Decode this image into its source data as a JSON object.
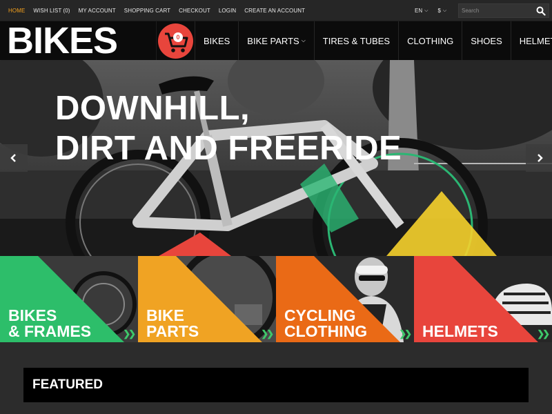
{
  "top_links": [
    {
      "label": "HOME",
      "active": true
    },
    {
      "label": "WISH LIST (0)",
      "active": false
    },
    {
      "label": "MY ACCOUNT",
      "active": false
    },
    {
      "label": "SHOPPING CART",
      "active": false
    },
    {
      "label": "CHECKOUT",
      "active": false
    },
    {
      "label": "LOGIN",
      "active": false
    },
    {
      "label": "CREATE AN ACCOUNT",
      "active": false
    }
  ],
  "language": "EN",
  "currency": "$",
  "search": {
    "placeholder": "Search",
    "value": ""
  },
  "logo": "BIKES",
  "cart": {
    "count": "0"
  },
  "nav": [
    {
      "label": "BIKES",
      "dropdown": false
    },
    {
      "label": "BIKE PARTS",
      "dropdown": true
    },
    {
      "label": "TIRES & TUBES",
      "dropdown": false
    },
    {
      "label": "CLOTHING",
      "dropdown": false
    },
    {
      "label": "SHOES",
      "dropdown": false
    },
    {
      "label": "HELMETS",
      "dropdown": false
    }
  ],
  "hero": {
    "line1": "DOWNHILL,",
    "line2": "DIRT AND FREERIDE"
  },
  "tiles": [
    {
      "line1": "BIKES",
      "line2": "& FRAMES",
      "color": "#2dbe6a"
    },
    {
      "line1": "BIKE",
      "line2": "PARTS",
      "color": "#f0a323"
    },
    {
      "line1": "CYCLING",
      "line2": "CLOTHING",
      "color": "#ea6a16"
    },
    {
      "line1": "",
      "line2": "HELMETS",
      "color": "#e8453c"
    }
  ],
  "featured": {
    "title": "FEATURED"
  },
  "colors": {
    "accent": "#f6a21c",
    "cart": "#e8453c",
    "chevron": "#3ec96a"
  }
}
